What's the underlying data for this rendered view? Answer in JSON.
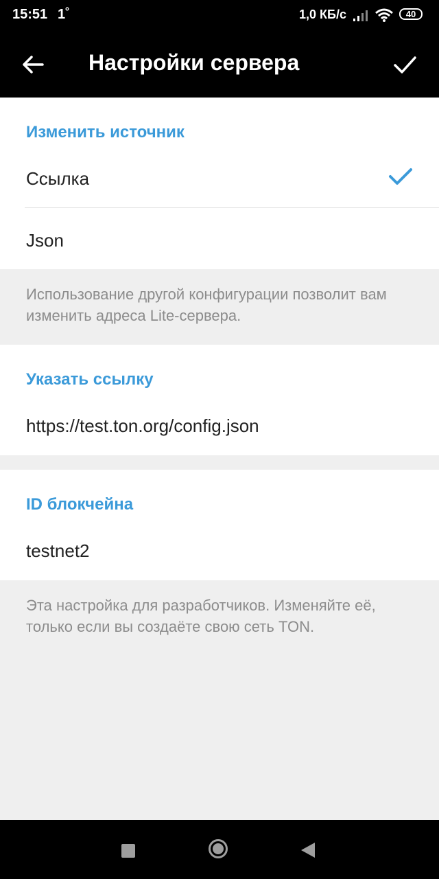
{
  "status_bar": {
    "time": "15:51",
    "temperature": "1˚",
    "speed": "1,0 КБ/с",
    "battery": "40"
  },
  "app_bar": {
    "title": "Настройки сервера"
  },
  "source_section": {
    "header": "Изменить источник",
    "options": [
      {
        "label": "Ссылка",
        "selected": true
      },
      {
        "label": "Json",
        "selected": false
      }
    ],
    "hint": "Использование другой конфигурации позволит вам изменить адреса Lite-сервера."
  },
  "url_section": {
    "header": "Указать ссылку",
    "value": "https://test.ton.org/config.json"
  },
  "blockchain_section": {
    "header": "ID блокчейна",
    "value": "testnet2",
    "hint": "Эта настройка для разработчиков. Изменяйте её, только если вы создаёте свою сеть TON."
  },
  "colors": {
    "accent": "#3b9ad9",
    "app_bar": "#000000",
    "background": "#efefef"
  },
  "icons": [
    "back-arrow-icon",
    "checkmark-icon",
    "selected-check-icon",
    "signal-icon",
    "wifi-icon",
    "nav-recent-icon",
    "nav-home-icon",
    "nav-back-icon"
  ]
}
